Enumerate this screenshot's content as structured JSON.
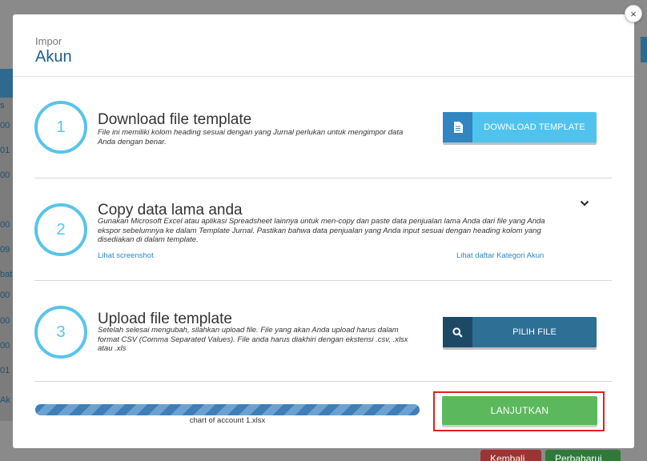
{
  "background": {
    "left_numbers": [
      "s",
      "00",
      "01",
      "00",
      "00",
      "09",
      "bata",
      "00",
      "00",
      "00",
      "01",
      "Ak"
    ],
    "buttons": {
      "back": "Kembali",
      "save": "Perbaharui"
    }
  },
  "modal": {
    "close_symbol": "×",
    "subtitle": "Impor",
    "title": "Akun"
  },
  "steps": [
    {
      "number": "1",
      "title": "Download file template",
      "description": "File ini memiliki kolom heading sesuai dengan yang Jurnal perlukan untuk mengimpor data Anda dengan benar.",
      "button": {
        "label": "DOWNLOAD TEMPLATE",
        "icon": "file-icon"
      }
    },
    {
      "number": "2",
      "title": "Copy data lama anda",
      "description": "Gunakan Microsoft Excel atau aplikasi Spreadsheet lainnya untuk men-copy dan paste data penjualan lama Anda dari file yang Anda ekspor sebelumnya ke dalam Template Jurnal. Pastikan bahwa data penjualan yang Anda input sesuai dengan heading kolom yang disediakan di dalam template.",
      "link_left": "Lihat screenshot",
      "link_right": "Lihat daftar Kategori Akun",
      "toggle_icon": "chevron-down-icon"
    },
    {
      "number": "3",
      "title": "Upload file template",
      "description": "Setelah selesai mengubah, silahkan upload file. File yang akan Anda upload harus dalam format CSV (Comma Separated Values). File anda harus diakhiri dengan ekstensi .csv, .xlsx atau .xls",
      "button": {
        "label": "PILIH FILE",
        "icon": "search-icon"
      }
    }
  ],
  "upload": {
    "progress_percent": 100,
    "file_name": "chart of account 1.xlsx"
  },
  "continue_button": "LANJUTKAN",
  "colors": {
    "accent_blue": "#4fc3ee",
    "dark_blue": "#2d6f95",
    "circle": "#59c4e8",
    "green": "#5cb85c",
    "highlight_red": "#e02020"
  }
}
